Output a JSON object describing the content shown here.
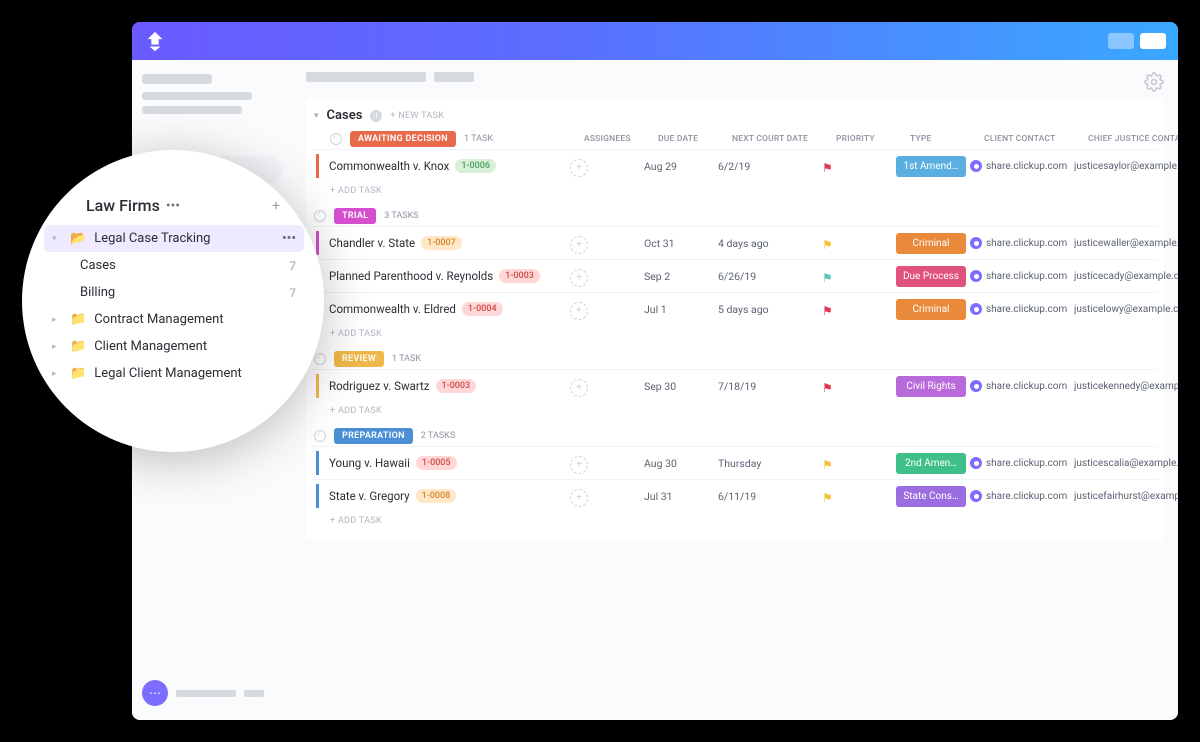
{
  "list_title": "Cases",
  "new_task_top": "+ NEW TASK",
  "add_task": "+ ADD TASK",
  "columns": {
    "assignees": "ASSIGNEES",
    "due_date": "DUE DATE",
    "next_court": "NEXT COURT DATE",
    "priority": "PRIORITY",
    "type": "TYPE",
    "client_contact": "CLIENT CONTACT",
    "chief_justice": "CHIEF JUSTICE CONTACT"
  },
  "client_contact_value": "share.clickup.com",
  "magnifier": {
    "space_title": "Law Firms",
    "items": [
      {
        "label": "Legal Case Tracking",
        "active": true
      },
      {
        "label": "Cases",
        "count": "7",
        "sub": true
      },
      {
        "label": "Billing",
        "count": "7",
        "sub": true
      },
      {
        "label": "Contract Management"
      },
      {
        "label": "Client Management"
      },
      {
        "label": "Legal Client Management"
      }
    ]
  },
  "groups": [
    {
      "name": "AWAITING DECISION",
      "color": "#e86a4a",
      "task_count": "1 TASK",
      "tasks": [
        {
          "name": "Commonwealth v. Knox",
          "id": "1-0006",
          "id_bg": "#d8f0d8",
          "id_fg": "#4aa060",
          "due": "Aug 29",
          "next": "6/2/19",
          "flag": "red",
          "type": "1st Amend…",
          "type_color": "#5aaee0",
          "chief": "justicesaylor@example.com"
        }
      ]
    },
    {
      "name": "TRIAL",
      "color": "#d64fcf",
      "task_count": "3 TASKS",
      "tasks": [
        {
          "name": "Chandler v. State",
          "id": "1-0007",
          "id_bg": "#ffe7c7",
          "id_fg": "#d0862c",
          "due": "Oct 31",
          "next": "4 days ago",
          "flag": "yellow",
          "type": "Criminal",
          "type_color": "#e88a3a",
          "chief": "justicewaller@example.com"
        },
        {
          "name": "Planned Parenthood v. Reynolds",
          "id": "1-0003",
          "id_bg": "#ffd7d7",
          "id_fg": "#d04a4a",
          "due": "Sep 2",
          "next": "6/26/19",
          "flag": "teal",
          "type": "Due Process",
          "type_color": "#e0527a",
          "chief": "justicecady@example.com"
        },
        {
          "name": "Commonwealth v. Eldred",
          "id": "1-0004",
          "id_bg": "#ffd7d7",
          "id_fg": "#d04a4a",
          "due": "Jul 1",
          "next": "5 days ago",
          "flag": "red",
          "type": "Criminal",
          "type_color": "#e88a3a",
          "chief": "justicelowy@example.com"
        }
      ]
    },
    {
      "name": "REVIEW",
      "color": "#f0b84a",
      "task_count": "1 TASK",
      "tasks": [
        {
          "name": "Rodriguez v. Swartz",
          "id": "1-0003",
          "id_bg": "#ffd7d7",
          "id_fg": "#d04a4a",
          "due": "Sep 30",
          "next": "7/18/19",
          "flag": "red",
          "type": "Civil Rights",
          "type_color": "#b86adb",
          "chief": "justicekennedy@example.com"
        }
      ]
    },
    {
      "name": "PREPARATION",
      "color": "#4a8fd6",
      "task_count": "2 TASKS",
      "tasks": [
        {
          "name": "Young v. Hawaii",
          "id": "1-0005",
          "id_bg": "#ffd7d7",
          "id_fg": "#d04a4a",
          "due": "Aug 30",
          "next": "Thursday",
          "flag": "yellow",
          "type": "2nd Amen…",
          "type_color": "#3fbf8a",
          "chief": "justicescalia@example.com"
        },
        {
          "name": "State v. Gregory",
          "id": "1-0008",
          "id_bg": "#ffe7c7",
          "id_fg": "#d0862c",
          "due": "Jul 31",
          "next": "6/11/19",
          "flag": "yellow",
          "type": "State Cons…",
          "type_color": "#9a6ee0",
          "chief": "justicefairhurst@example.com"
        }
      ]
    }
  ]
}
